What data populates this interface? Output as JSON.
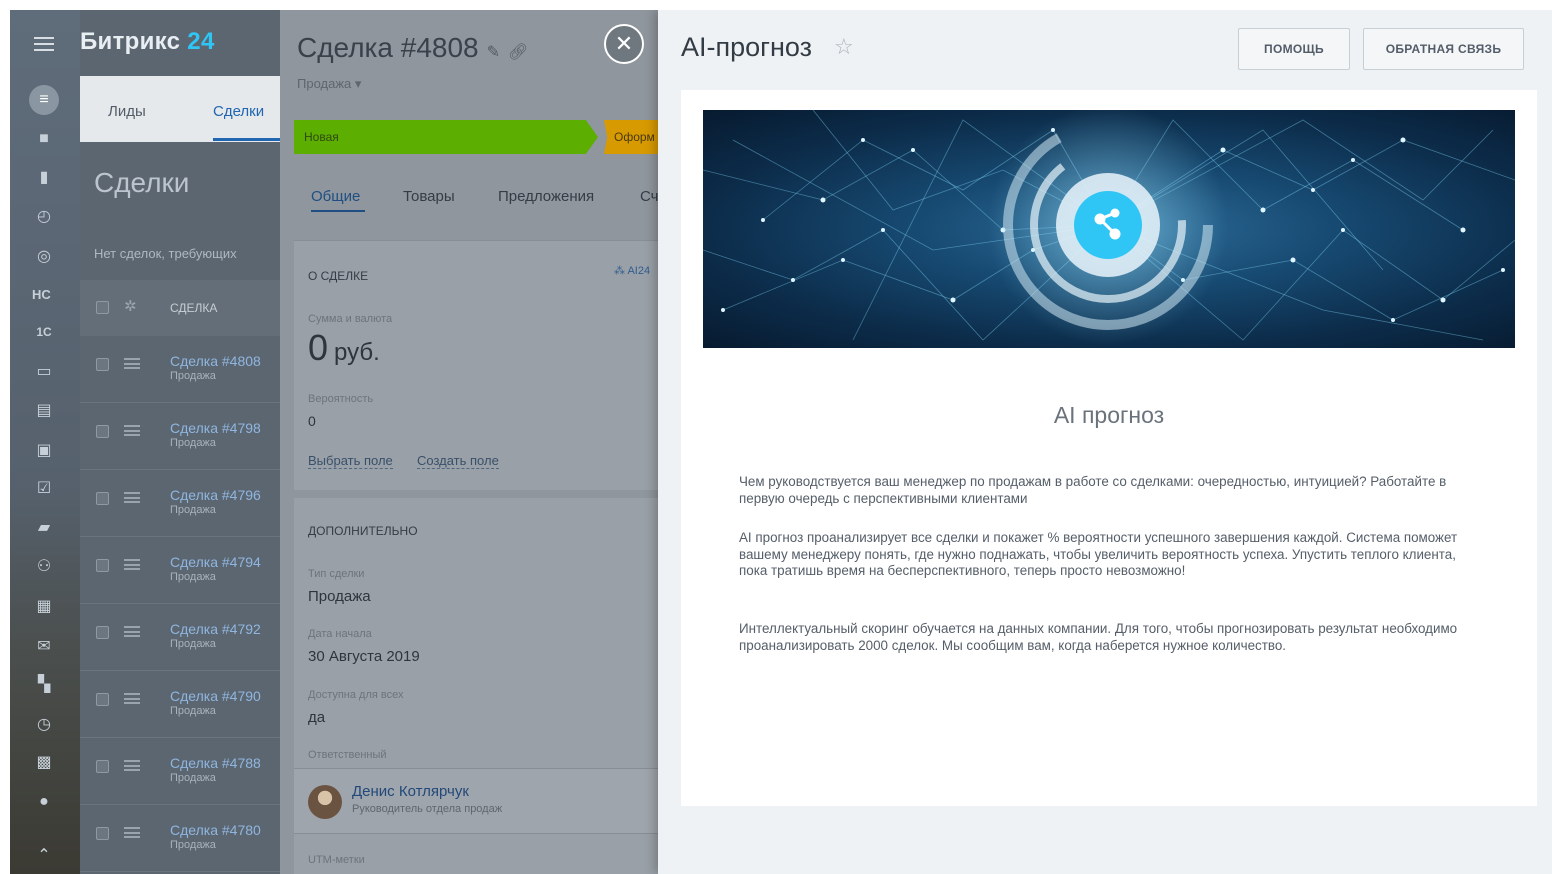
{
  "brand": {
    "name": "Битрикс",
    "number": "24",
    "accent": "#2fc6f6"
  },
  "rail": {
    "icons": [
      "menu-icon",
      "filter-icon",
      "briefcase-icon",
      "chart-icon",
      "clock-icon",
      "target-icon",
      "1c-icon",
      "monitor-icon",
      "storage-icon",
      "save-icon",
      "tasks-icon",
      "chat-icon",
      "group-icon",
      "calendar-icon",
      "mail-icon",
      "apps-icon",
      "time-icon",
      "contact-card-icon",
      "chevron-circle-icon",
      "up-arrow-icon"
    ],
    "hc_label": "HC",
    "onec_label": "1С"
  },
  "list": {
    "tabs": [
      {
        "label": "Лиды"
      },
      {
        "label": "Сделки"
      }
    ],
    "title": "Сделки",
    "filter_text": "Нет сделок, требующих",
    "column_header": "СДЕЛКА",
    "rows": [
      {
        "name": "Сделка #4808",
        "sub": "Продажа"
      },
      {
        "name": "Сделка #4798",
        "sub": "Продажа"
      },
      {
        "name": "Сделка #4796",
        "sub": "Продажа"
      },
      {
        "name": "Сделка #4794",
        "sub": "Продажа"
      },
      {
        "name": "Сделка #4792",
        "sub": "Продажа"
      },
      {
        "name": "Сделка #4790",
        "sub": "Продажа"
      },
      {
        "name": "Сделка #4788",
        "sub": "Продажа"
      },
      {
        "name": "Сделка #4780",
        "sub": "Продажа"
      }
    ]
  },
  "deal": {
    "title": "Сделка #4808",
    "pipeline": "Продажа ▾",
    "stages": [
      {
        "label": "Новая",
        "color": "#5cae00"
      },
      {
        "label": "Оформ",
        "color": "#d79a00"
      }
    ],
    "tabs": [
      "Общие",
      "Товары",
      "Предложения",
      "Сч"
    ],
    "about": {
      "heading": "О СДЕЛКЕ",
      "ai_link": "AI24",
      "sum_label": "Сумма и валюта",
      "sum_value": "0",
      "currency": "руб.",
      "prob_label": "Вероятность",
      "prob_value": "0",
      "select_field": "Выбрать поле",
      "create_field": "Создать поле"
    },
    "extra": {
      "heading": "ДОПОЛНИТЕЛЬНО",
      "type_label": "Тип сделки",
      "type_value": "Продажа",
      "start_label": "Дата начала",
      "start_value": "30 Августа 2019",
      "public_label": "Доступна для всех",
      "public_value": "да",
      "resp_label": "Ответственный",
      "resp_name": "Денис Котлярчук",
      "resp_position": "Руководитель отдела продаж",
      "utm_label": "UTM-метки"
    }
  },
  "ai_panel": {
    "title": "AI-прогноз",
    "help_button": "ПОМОЩЬ",
    "feedback_button": "ОБРАТНАЯ СВЯЗЬ",
    "content_title": "AI прогноз",
    "paragraphs": [
      "Чем руководствуется ваш менеджер по продажам в работе со сделками: очередностью, интуицией? Работайте в первую очередь с перспективными клиентами",
      "AI прогноз проанализирует все сделки и покажет % вероятности успешного завершения каждой. Система поможет вашему менеджеру понять, где нужно поднажать, чтобы увеличить вероятность успеха. Упустить теплого клиента, пока тратишь время на бесперспективного, теперь просто невозможно!",
      "Интеллектуальный скоринг обучается на данных компании. Для того, чтобы прогнозировать результат необходимо проанализировать 2000 сделок. Мы сообщим вам, когда наберется нужное количество."
    ]
  }
}
